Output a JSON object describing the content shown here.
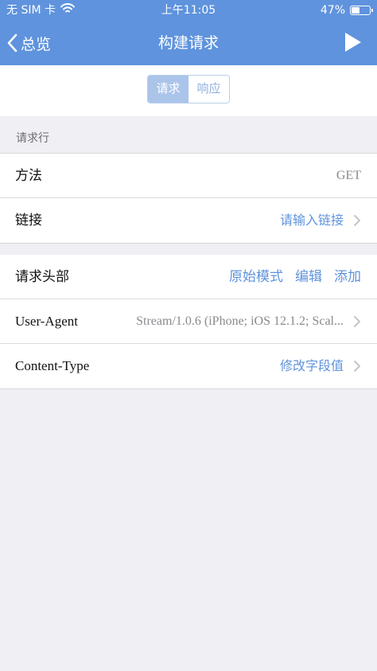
{
  "status_bar": {
    "carrier": "无 SIM 卡",
    "time": "上午11:05",
    "battery": "47%",
    "battery_level": 0.47
  },
  "nav": {
    "back_label": "总览",
    "title": "构建请求",
    "play_icon": "play-icon"
  },
  "segments": {
    "request": "请求",
    "response": "响应",
    "selected": "request"
  },
  "request_line": {
    "section_title": "请求行",
    "method_label": "方法",
    "method_value": "GET",
    "url_label": "链接",
    "url_placeholder": "请输入链接"
  },
  "headers": {
    "title": "请求头部",
    "raw_mode": "原始模式",
    "edit": "编辑",
    "add": "添加",
    "items": [
      {
        "name": "User-Agent",
        "value": "Stream/1.0.6 (iPhone; iOS 12.1.2; Scal..."
      },
      {
        "name": "Content-Type",
        "value": "修改字段值"
      }
    ]
  },
  "colors": {
    "accent": "#5f93dd",
    "background": "#efeff4"
  }
}
